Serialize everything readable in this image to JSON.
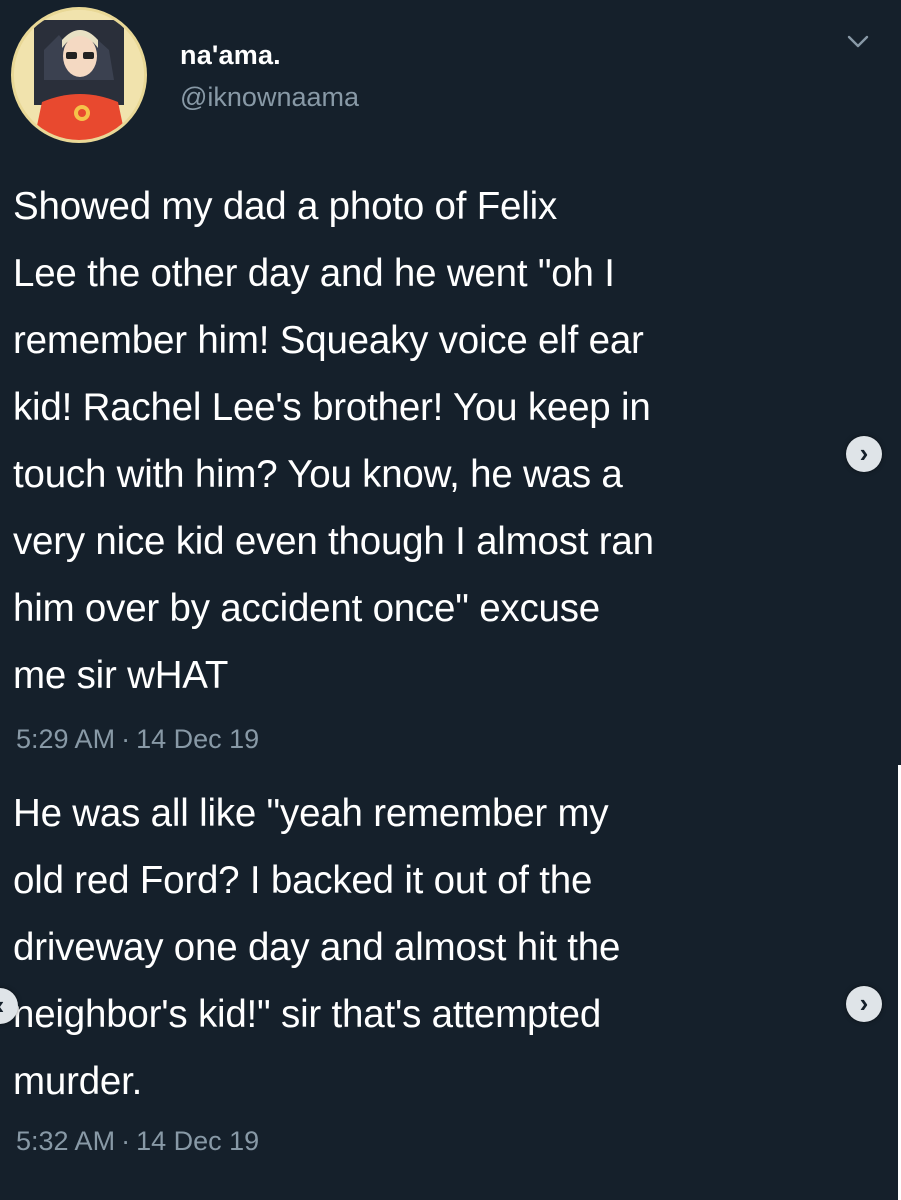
{
  "profile": {
    "display_name": "na'ama.",
    "handle": "@iknownaama"
  },
  "tweets": [
    {
      "text": "Showed my dad a photo of Felix\nLee the other day and he went \"oh I\nremember him! Squeaky voice elf ear\nkid! Rachel Lee's brother! You keep in\ntouch with him? You know, he was a\nvery nice kid even though I almost ran\nhim over by accident once\" excuse\nme sir wHAT",
      "time": "5:29 AM",
      "date": "14 Dec 19"
    },
    {
      "text": "He was all like \"yeah remember my\nold red Ford? I backed it out of the\ndriveway one day and almost hit the\nneighbor's kid!\" sir that's attempted\nmurder.",
      "time": "5:32 AM",
      "date": "14 Dec 19"
    }
  ],
  "separator": "·",
  "icons": {
    "menu": "chevron-down-icon",
    "next": "chevron-right-icon",
    "prev": "chevron-left-icon",
    "next_glyph": "›",
    "prev_glyph": "‹"
  },
  "colors": {
    "background": "#15202b",
    "text": "#ffffff",
    "secondary_text": "#8899a6"
  }
}
